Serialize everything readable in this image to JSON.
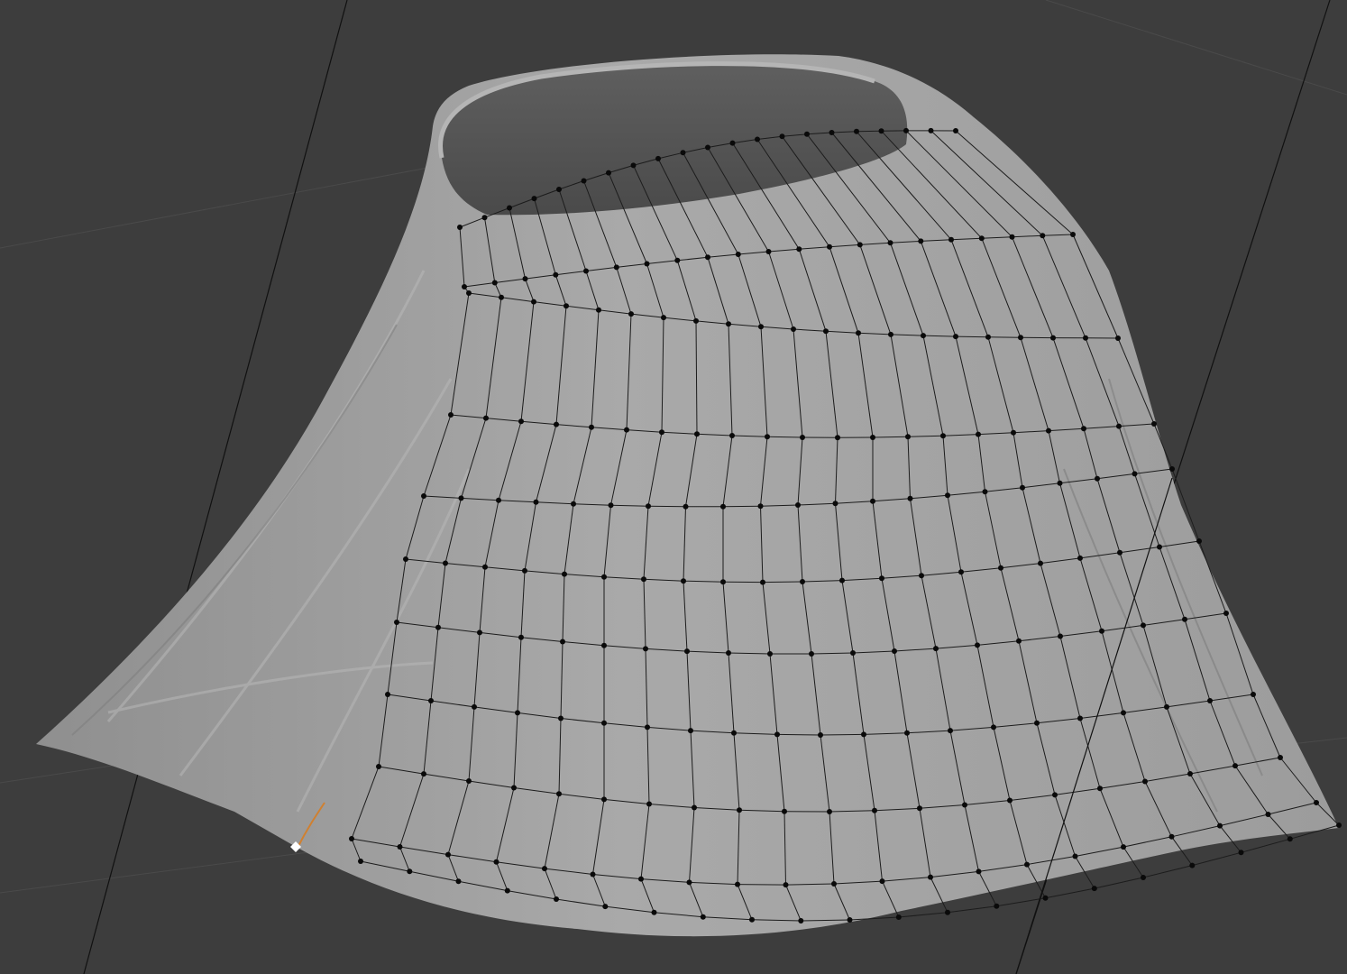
{
  "viewport": {
    "background_color": "#3d3d3d",
    "grid_line_color": "#4a4a4a",
    "axis_line_color": "#101010",
    "mesh_color": "#9a9a9a",
    "wire_color": "#1c1c1c",
    "vertex_color": "#0a0a0a",
    "active_vertex_color": "#ffffff",
    "active_edge_color": "#d08030"
  },
  "object": {
    "type": "skirt-mesh",
    "mode": "edit-mode"
  }
}
